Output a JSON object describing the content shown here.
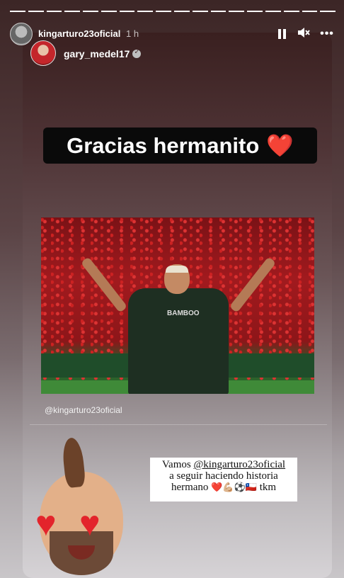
{
  "header": {
    "username": "kingarturo23oficial",
    "time": "1 h",
    "pause_icon": "pause-icon",
    "mute_icon": "mute-icon",
    "more_label": "•••"
  },
  "progress": {
    "segments": 18,
    "current_index": 17
  },
  "reshared": {
    "username": "gary_medel17",
    "verified": true
  },
  "sticker": {
    "text": "Gracias hermanito",
    "emoji": "❤️"
  },
  "photo": {
    "shirt_text": "BAMBOO"
  },
  "tag": {
    "text": "@kingarturo23oficial"
  },
  "caption": {
    "line1_prefix": "Vamos ",
    "line1_mention": "@kingarturo23oficial",
    "line2": "a seguir haciendo historia",
    "line3_text": "hermano ",
    "line3_emojis": "❤️💪🏼⚽🇨🇱",
    "line3_suffix": " tkm"
  },
  "colors": {
    "accent_heart": "#e3242b",
    "sticker_bg": "#0a0a0a"
  }
}
